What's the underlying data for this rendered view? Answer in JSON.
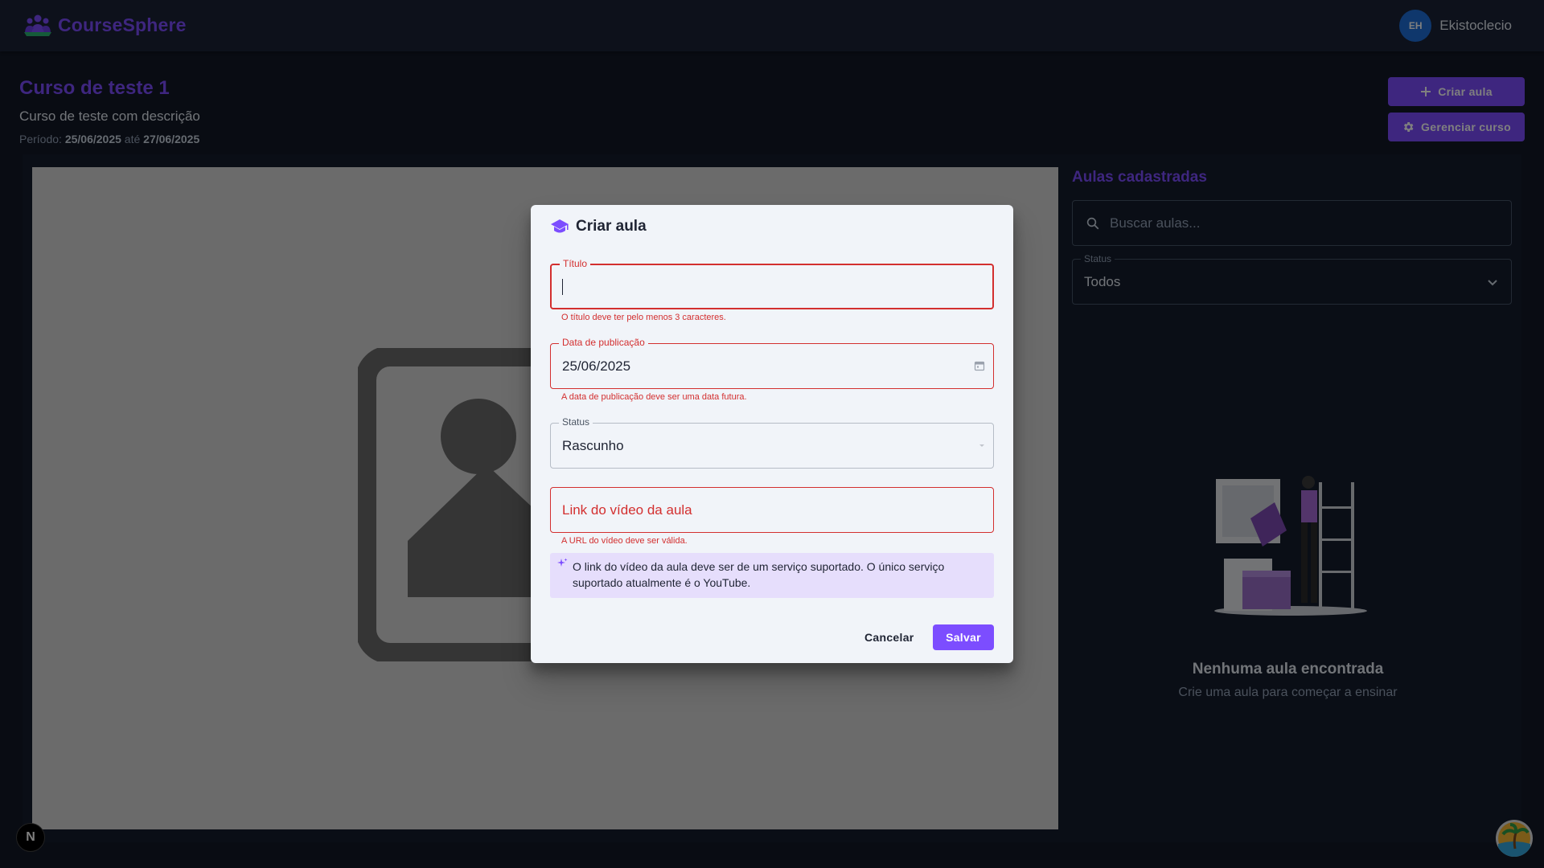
{
  "header": {
    "brand": "CourseSphere",
    "avatar_initials": "EH",
    "username": "Ekistoclecio"
  },
  "course": {
    "title": "Curso de teste 1",
    "description": "Curso de teste com descrição",
    "period_label": "Período:",
    "period_start": "25/06/2025",
    "period_sep": "até",
    "period_end": "27/06/2025"
  },
  "actions": {
    "create_lesson": "Criar aula",
    "manage_course": "Gerenciar curso"
  },
  "sidebar": {
    "title": "Aulas cadastradas",
    "search_placeholder": "Buscar aulas...",
    "status_label": "Status",
    "status_value": "Todos",
    "empty_title": "Nenhuma aula encontrada",
    "empty_subtitle": "Crie uma aula para começar a ensinar"
  },
  "dialog": {
    "title": "Criar aula",
    "titulo_label": "Título",
    "titulo_value": "",
    "titulo_error": "O título deve ter pelo menos 3 caracteres.",
    "data_label": "Data de publicação",
    "data_value": "25/06/2025",
    "data_error": "A data de publicação deve ser uma data futura.",
    "status_label": "Status",
    "status_value": "Rascunho",
    "link_placeholder": "Link do vídeo da aula",
    "link_error": "A URL do vídeo deve ser válida.",
    "info_text": "O link do vídeo da aula deve ser de um serviço suportado. O único serviço suportado atualmente é o YouTube.",
    "cancel": "Cancelar",
    "save": "Salvar"
  },
  "dev_badge": "N",
  "colors": {
    "accent": "#7c4dff",
    "error": "#d32f2f",
    "background": "#121826",
    "dialog": "#f1f4f9"
  }
}
